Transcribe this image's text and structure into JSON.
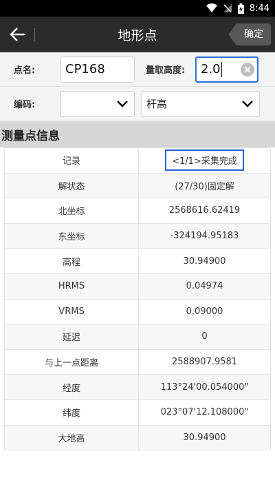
{
  "status": {
    "time": "8:44"
  },
  "appbar": {
    "title": "地形点",
    "confirm_label": "确定"
  },
  "form": {
    "point_name_label": "点名:",
    "point_name_value": "CP168",
    "height_label": "量取高度:",
    "height_value": "2.0",
    "code_label": "编码:",
    "code_value": "",
    "height_type_value": "杆高"
  },
  "section": {
    "title": "测量点信息"
  },
  "table": {
    "rows": [
      {
        "key": "记录",
        "value": "<1/1>采集完成"
      },
      {
        "key": "解状态",
        "value": "(27/30)固定解"
      },
      {
        "key": "北坐标",
        "value": "2568616.62419"
      },
      {
        "key": "东坐标",
        "value": "-324194.95183"
      },
      {
        "key": "高程",
        "value": "30.94900"
      },
      {
        "key": "HRMS",
        "value": "0.04974"
      },
      {
        "key": "VRMS",
        "value": "0.09000"
      },
      {
        "key": "延迟",
        "value": "0"
      },
      {
        "key": "与上一点距离",
        "value": "2588907.9581"
      },
      {
        "key": "经度",
        "value": "113°24'00.054000\""
      },
      {
        "key": "纬度",
        "value": "023°07'12.108000\""
      },
      {
        "key": "大地高",
        "value": "30.94900"
      }
    ]
  }
}
